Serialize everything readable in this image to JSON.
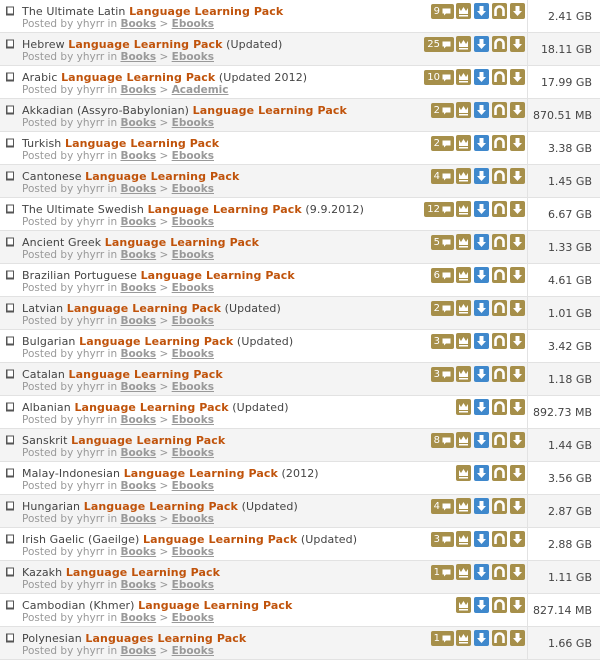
{
  "icons": {
    "type_icon": "book-icon",
    "comment_icon": "speech-bubble-icon",
    "vip_icon": "crown-icon",
    "download_icon": "arrow-down-icon",
    "magnet_icon": "magnet-icon",
    "torrent_icon": "arrow-down-icon"
  },
  "colors": {
    "title_highlight": "#c0530b",
    "gold_button": "#a68f4a",
    "blue_button": "#3f88cc"
  },
  "posted_prefix": "Posted by",
  "in_word": "in",
  "separator": ">",
  "rows": [
    {
      "pre": "The Ultimate Latin ",
      "hl": "Language Learning Pack",
      "post": "",
      "user": "yhyrr",
      "category": "Books",
      "subcategory": "Ebooks",
      "comments": "9",
      "size": "2.41 GB"
    },
    {
      "pre": "Hebrew ",
      "hl": "Language Learning Pack",
      "post": " (Updated)",
      "user": "yhyrr",
      "category": "Books",
      "subcategory": "Ebooks",
      "comments": "25",
      "size": "18.11 GB"
    },
    {
      "pre": "Arabic ",
      "hl": "Language Learning Pack",
      "post": " (Updated 2012)",
      "user": "yhyrr",
      "category": "Books",
      "subcategory": "Academic",
      "comments": "10",
      "size": "17.99 GB"
    },
    {
      "pre": "Akkadian (Assyro-Babylonian) ",
      "hl": "Language Learning Pack",
      "post": "",
      "user": "yhyrr",
      "category": "Books",
      "subcategory": "Ebooks",
      "comments": "2",
      "size": "870.51 MB"
    },
    {
      "pre": "Turkish ",
      "hl": "Language Learning Pack",
      "post": "",
      "user": "yhyrr",
      "category": "Books",
      "subcategory": "Ebooks",
      "comments": "2",
      "size": "3.38 GB"
    },
    {
      "pre": "Cantonese ",
      "hl": "Language Learning Pack",
      "post": "",
      "user": "yhyrr",
      "category": "Books",
      "subcategory": "Ebooks",
      "comments": "4",
      "size": "1.45 GB"
    },
    {
      "pre": "The Ultimate Swedish ",
      "hl": "Language Learning Pack",
      "post": " (9.9.2012)",
      "user": "yhyrr",
      "category": "Books",
      "subcategory": "Ebooks",
      "comments": "12",
      "size": "6.67 GB"
    },
    {
      "pre": "Ancient Greek ",
      "hl": "Language Learning Pack",
      "post": "",
      "user": "yhyrr",
      "category": "Books",
      "subcategory": "Ebooks",
      "comments": "5",
      "size": "1.33 GB"
    },
    {
      "pre": "Brazilian Portuguese ",
      "hl": "Language Learning Pack",
      "post": "",
      "user": "yhyrr",
      "category": "Books",
      "subcategory": "Ebooks",
      "comments": "6",
      "size": "4.61 GB"
    },
    {
      "pre": "Latvian ",
      "hl": "Language Learning Pack",
      "post": " (Updated)",
      "user": "yhyrr",
      "category": "Books",
      "subcategory": "Ebooks",
      "comments": "2",
      "size": "1.01 GB"
    },
    {
      "pre": "Bulgarian ",
      "hl": "Language Learning Pack",
      "post": " (Updated)",
      "user": "yhyrr",
      "category": "Books",
      "subcategory": "Ebooks",
      "comments": "3",
      "size": "3.42 GB"
    },
    {
      "pre": "Catalan ",
      "hl": "Language Learning Pack",
      "post": "",
      "user": "yhyrr",
      "category": "Books",
      "subcategory": "Ebooks",
      "comments": "3",
      "size": "1.18 GB"
    },
    {
      "pre": "Albanian ",
      "hl": "Language Learning Pack",
      "post": " (Updated)",
      "user": "yhyrr",
      "category": "Books",
      "subcategory": "Ebooks",
      "comments": "",
      "size": "892.73 MB"
    },
    {
      "pre": "Sanskrit ",
      "hl": "Language Learning Pack",
      "post": "",
      "user": "yhyrr",
      "category": "Books",
      "subcategory": "Ebooks",
      "comments": "8",
      "size": "1.44 GB"
    },
    {
      "pre": "Malay-Indonesian ",
      "hl": "Language Learning Pack",
      "post": " (2012)",
      "user": "yhyrr",
      "category": "Books",
      "subcategory": "Ebooks",
      "comments": "",
      "size": "3.56 GB"
    },
    {
      "pre": "Hungarian ",
      "hl": "Language Learning Pack",
      "post": " (Updated)",
      "user": "yhyrr",
      "category": "Books",
      "subcategory": "Ebooks",
      "comments": "4",
      "size": "2.87 GB"
    },
    {
      "pre": "Irish Gaelic (Gaeilge) ",
      "hl": "Language Learning Pack",
      "post": " (Updated)",
      "user": "yhyrr",
      "category": "Books",
      "subcategory": "Ebooks",
      "comments": "3",
      "size": "2.88 GB"
    },
    {
      "pre": "Kazakh ",
      "hl": "Language Learning Pack",
      "post": "",
      "user": "yhyrr",
      "category": "Books",
      "subcategory": "Ebooks",
      "comments": "1",
      "size": "1.11 GB"
    },
    {
      "pre": "Cambodian (Khmer) ",
      "hl": "Language Learning Pack",
      "post": "",
      "user": "yhyrr",
      "category": "Books",
      "subcategory": "Ebooks",
      "comments": "",
      "size": "827.14 MB"
    },
    {
      "pre": "Polynesian ",
      "hl": "Languages Learning Pack",
      "post": "",
      "user": "yhyrr",
      "category": "Books",
      "subcategory": "Ebooks",
      "comments": "1",
      "size": "1.66 GB"
    }
  ]
}
